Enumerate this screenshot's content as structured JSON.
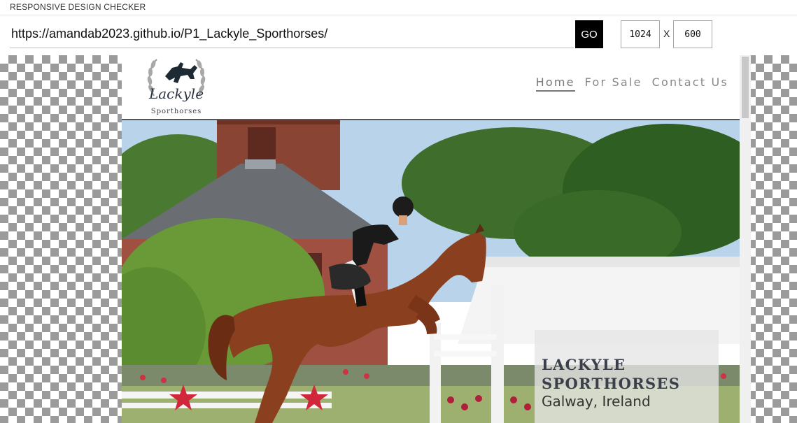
{
  "app": {
    "title": "RESPONSIVE DESIGN CHECKER"
  },
  "toolbar": {
    "url": "https://amandab2023.github.io/P1_Lackyle_Sporthorses/",
    "go_label": "GO",
    "width_value": "1024",
    "separator": "X",
    "height_value": "600"
  },
  "site": {
    "logo": {
      "name": "Lackyle",
      "sub": "Sporthorses"
    },
    "nav": [
      {
        "label": "Home",
        "active": true
      },
      {
        "label": "For Sale",
        "active": false
      },
      {
        "label": "Contact Us",
        "active": false
      }
    ],
    "hero": {
      "title_line1": "LACKYLE",
      "title_line2": "SPORTHORSES",
      "subtitle": "Galway, Ireland"
    }
  },
  "colors": {
    "go_button": "#000000",
    "checker": "#9b9b9b",
    "nav_text": "#888888",
    "caption_title": "#3a3f4a"
  },
  "icons": [
    "checkerboard-background",
    "wreath-logo-icon",
    "horse-jumper-icon"
  ]
}
